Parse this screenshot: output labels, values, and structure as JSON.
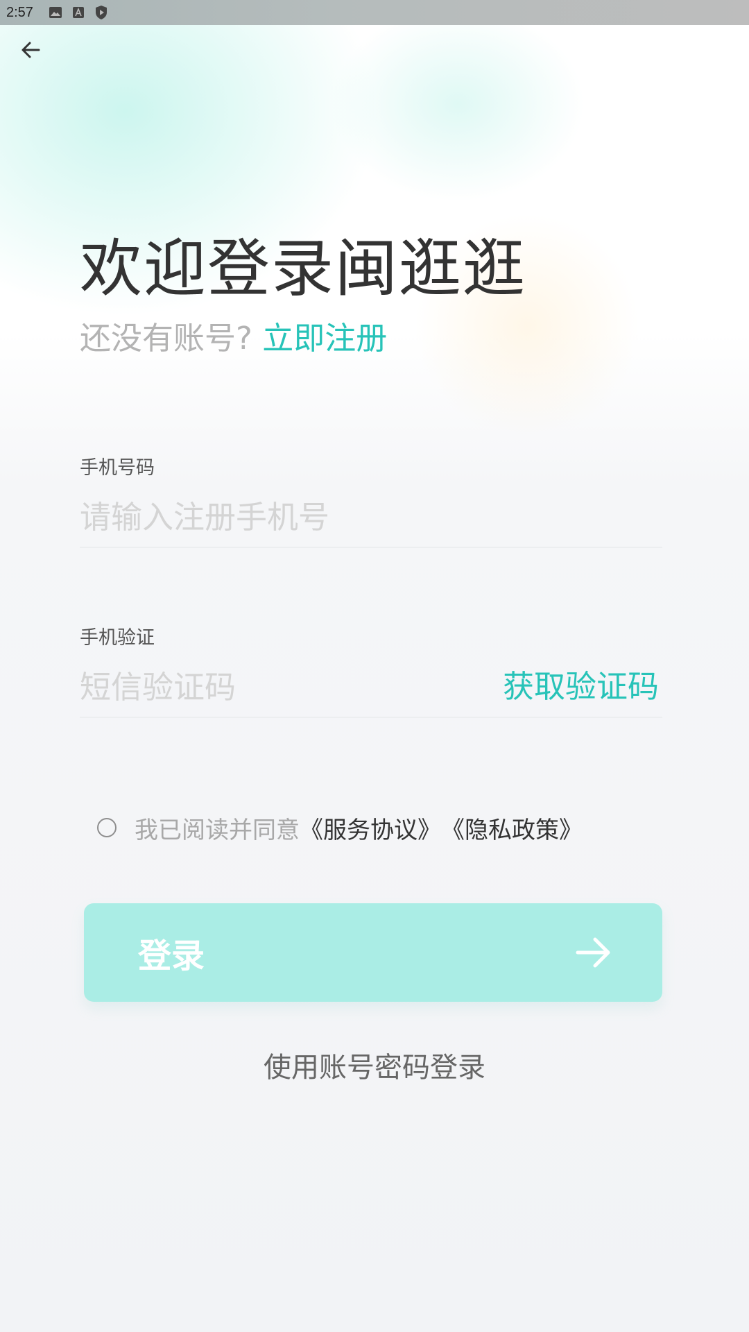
{
  "status_bar": {
    "time": "2:57",
    "icons": [
      "image-icon",
      "font-a-icon",
      "shield-play-icon"
    ]
  },
  "header": {
    "back_icon": "arrow-left-icon",
    "title": "欢迎登录闽逛逛",
    "subtitle_question": "还没有账号?",
    "register_link": "立即注册"
  },
  "form": {
    "phone": {
      "label": "手机号码",
      "placeholder": "请输入注册手机号",
      "value": ""
    },
    "code": {
      "label": "手机验证",
      "placeholder": "短信验证码",
      "value": "",
      "get_code": "获取验证码"
    }
  },
  "agreement": {
    "checked": false,
    "text": "我已阅读并同意",
    "service_link": "《服务协议》",
    "privacy_link": "《隐私政策》"
  },
  "login_button": {
    "label": "登录",
    "arrow_icon": "arrow-right-icon"
  },
  "alt_login": "使用账号密码登录",
  "colors": {
    "accent": "#27c3b8",
    "login_button_bg": "#aaede5",
    "title_text": "#333333",
    "placeholder_text": "#d4d4d4"
  }
}
